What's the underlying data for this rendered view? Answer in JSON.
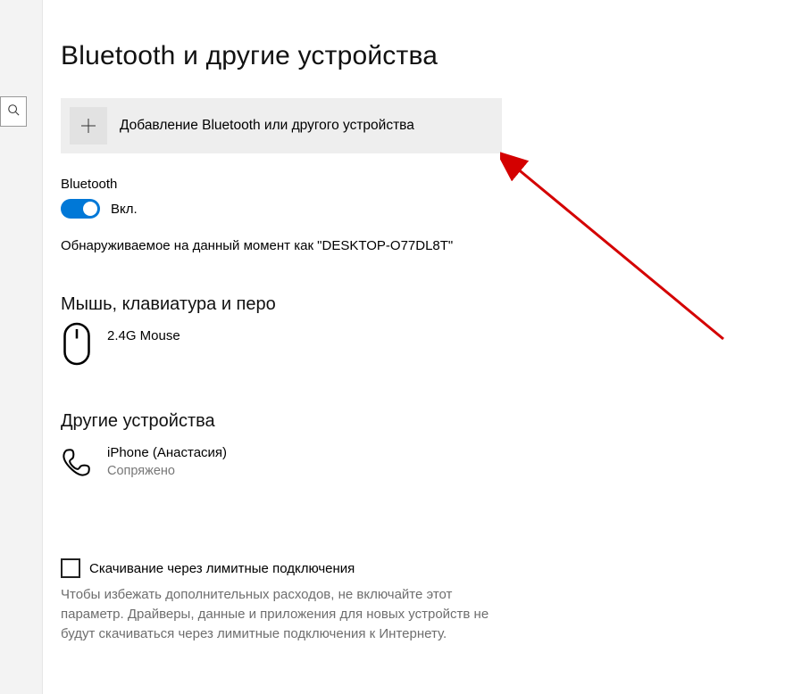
{
  "page": {
    "title": "Bluetooth и другие устройства"
  },
  "add_device": {
    "label": "Добавление Bluetooth или другого устройства"
  },
  "bluetooth": {
    "label": "Bluetooth",
    "state_text": "Вкл.",
    "discoverable_text": "Обнаруживаемое на данный момент как \"DESKTOP-O77DL8T\""
  },
  "sections": {
    "mouse_keyboard_pen": {
      "title": "Мышь, клавиатура и перо",
      "device": {
        "name": "2.4G Mouse"
      }
    },
    "other_devices": {
      "title": "Другие устройства",
      "device": {
        "name": "iPhone (Анастасия)",
        "status": "Сопряжено"
      }
    }
  },
  "metered": {
    "checkbox_label": "Скачивание через лимитные подключения",
    "help_text": "Чтобы избежать дополнительных расходов, не включайте этот параметр. Драйверы, данные и приложения для новых устройств не будут скачиваться через лимитные подключения к Интернету."
  }
}
